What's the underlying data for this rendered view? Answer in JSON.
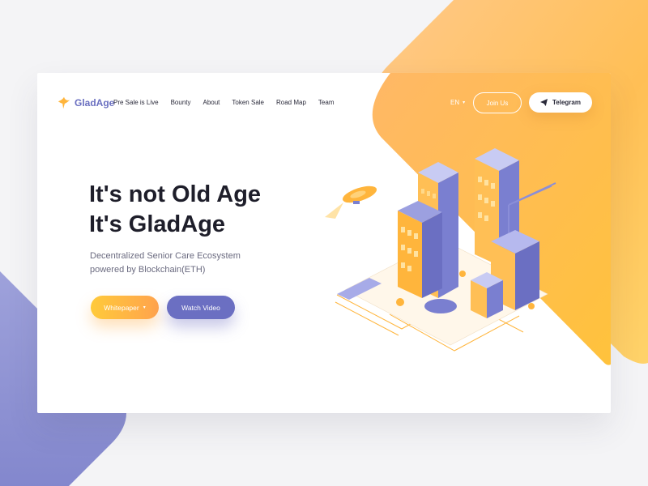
{
  "brand": {
    "name": "GladAge"
  },
  "nav": {
    "items": [
      "Pre Sale is Live",
      "Bounty",
      "About",
      "Token Sale",
      "Road Map",
      "Team"
    ]
  },
  "header": {
    "language": "EN",
    "join_label": "Join Us",
    "telegram_label": "Telegram"
  },
  "hero": {
    "title_line1": "It's not Old Age",
    "title_line2": "It's GladAge",
    "subtitle_line1": "Decentralized Senior Care Ecosystem",
    "subtitle_line2": "powered by Blockchain(ETH)",
    "whitepaper_label": "Whitepaper",
    "watch_label": "Watch Video"
  },
  "colors": {
    "accent_orange": "#ffb547",
    "accent_purple": "#6b6fc2",
    "text_dark": "#1e1e2a"
  },
  "icons": {
    "logo": "bird-icon",
    "language_caret": "chevron-down-icon",
    "telegram": "paper-plane-icon",
    "whitepaper_caret": "chevron-down-icon"
  }
}
